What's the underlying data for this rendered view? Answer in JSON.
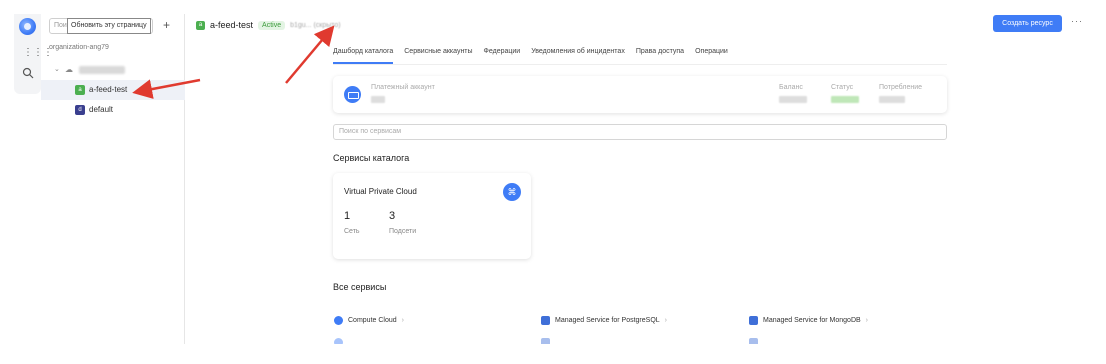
{
  "tree": {
    "search_placeholder": "Пои",
    "tooltip": "Обновить эту страницу",
    "add_label": "+",
    "organization": "organization-ang79",
    "items": [
      {
        "badge": "a",
        "label": "a-feed-test",
        "color": "#4caf50"
      },
      {
        "badge": "d",
        "label": "default",
        "color": "#3a3f8f"
      }
    ]
  },
  "header": {
    "folder_badge": "a",
    "folder_name": "a-feed-test",
    "status": "Active",
    "folder_id": "b1gu... (скрыто)",
    "create_button": "Создать ресурс",
    "more": "···"
  },
  "tabs": [
    "Дашборд каталога",
    "Сервисные аккаунты",
    "Федерации",
    "Уведомления об инцидентах",
    "Права доступа",
    "Операции"
  ],
  "billing": {
    "account_label": "Платежный аккаунт",
    "balance_label": "Баланс",
    "status_label": "Статус",
    "consumption_label": "Потребление"
  },
  "services_search_placeholder": "Поиск по сервисам",
  "catalog_services_title": "Сервисы каталога",
  "vpc_card": {
    "title": "Virtual Private Cloud",
    "networks_count": "1",
    "networks_label": "Сеть",
    "subnets_count": "3",
    "subnets_label": "Подсети"
  },
  "all_services_title": "Все сервисы",
  "all_services": [
    "Compute Cloud",
    "Managed Service for PostgreSQL",
    "Managed Service for MongoDB"
  ],
  "colors": {
    "accent": "#3f7cf6",
    "active_green": "#4caf50",
    "annotation_red": "#e03a2f"
  },
  "icons": {
    "rail_logo": "cloud-logo-icon",
    "rail_apps": "apps-grid-icon",
    "rail_search": "search-icon",
    "billing": "credit-card-icon",
    "vpc": "network-icon"
  }
}
